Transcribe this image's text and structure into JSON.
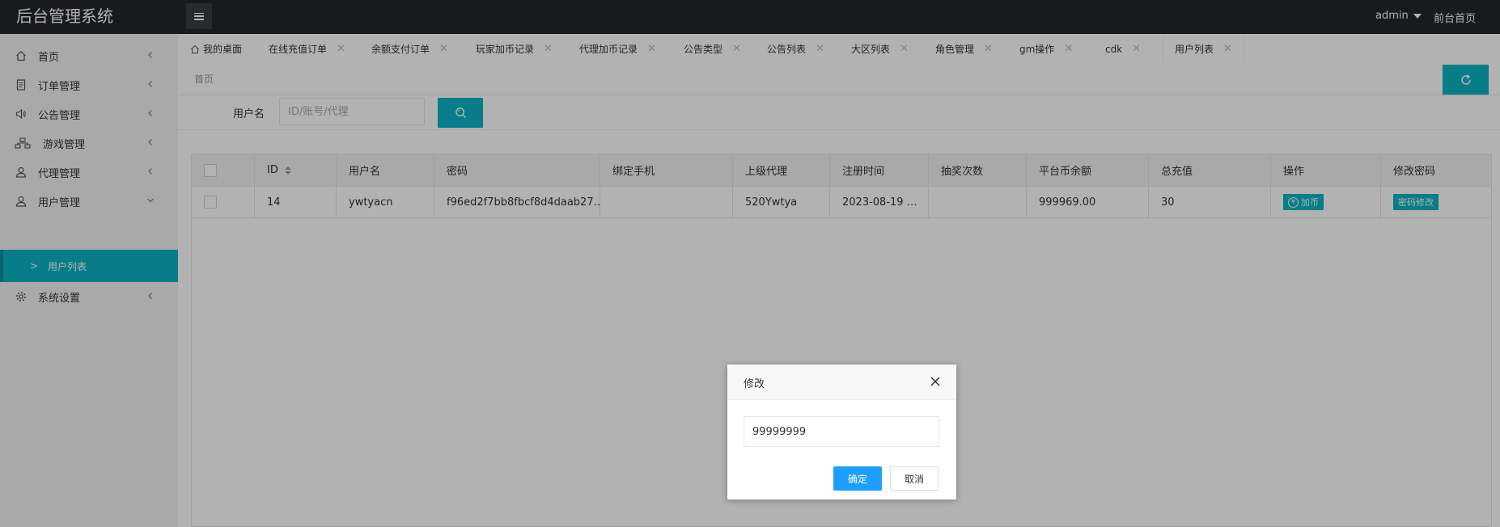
{
  "header": {
    "brand": "后台管理系统",
    "user": "admin",
    "front_home": "前台首页"
  },
  "sidebar": {
    "items": [
      {
        "label": "首页",
        "icon": "home-icon"
      },
      {
        "label": "订单管理",
        "icon": "document-icon"
      },
      {
        "label": "公告管理",
        "icon": "speaker-icon"
      },
      {
        "label": "游戏管理",
        "icon": "sitemap-icon"
      },
      {
        "label": "代理管理",
        "icon": "user-icon"
      },
      {
        "label": "用户管理",
        "icon": "user-icon"
      },
      {
        "label": "系统设置",
        "icon": "gear-icon"
      }
    ],
    "active_sub": "用户列表"
  },
  "tabs": [
    {
      "label": "我的桌面"
    },
    {
      "label": "在线充值订单"
    },
    {
      "label": "余额支付订单"
    },
    {
      "label": "玩家加币记录"
    },
    {
      "label": "代理加币记录"
    },
    {
      "label": "公告类型"
    },
    {
      "label": "公告列表"
    },
    {
      "label": "大区列表"
    },
    {
      "label": "角色管理"
    },
    {
      "label": "gm操作"
    },
    {
      "label": "cdk"
    },
    {
      "label": "用户列表"
    }
  ],
  "breadcrumb": "首页",
  "search": {
    "label": "用户名",
    "placeholder": "ID/账号/代理"
  },
  "table": {
    "columns": [
      "ID",
      "用户名",
      "密码",
      "绑定手机",
      "上级代理",
      "注册时间",
      "抽奖次数",
      "平台币余额",
      "总充值",
      "操作",
      "修改密码"
    ],
    "rows": [
      {
        "id": "14",
        "username": "ywtyacn",
        "password": "f96ed2f7bb8fbcf8d4daab27…",
        "phone": "",
        "agent": "520Ywtya",
        "reg_time": "2023-08-19 …",
        "draws": "",
        "balance": "999969.00",
        "total_recharge": "30",
        "action_label": "加币",
        "change_pw_label": "密码修改"
      }
    ]
  },
  "modal": {
    "title": "修改",
    "input_value": "99999999",
    "confirm": "确定",
    "cancel": "取消"
  },
  "colors": {
    "accent": "#0ab4c5",
    "primary_button": "#1e9fff",
    "topbar": "#23262e"
  }
}
